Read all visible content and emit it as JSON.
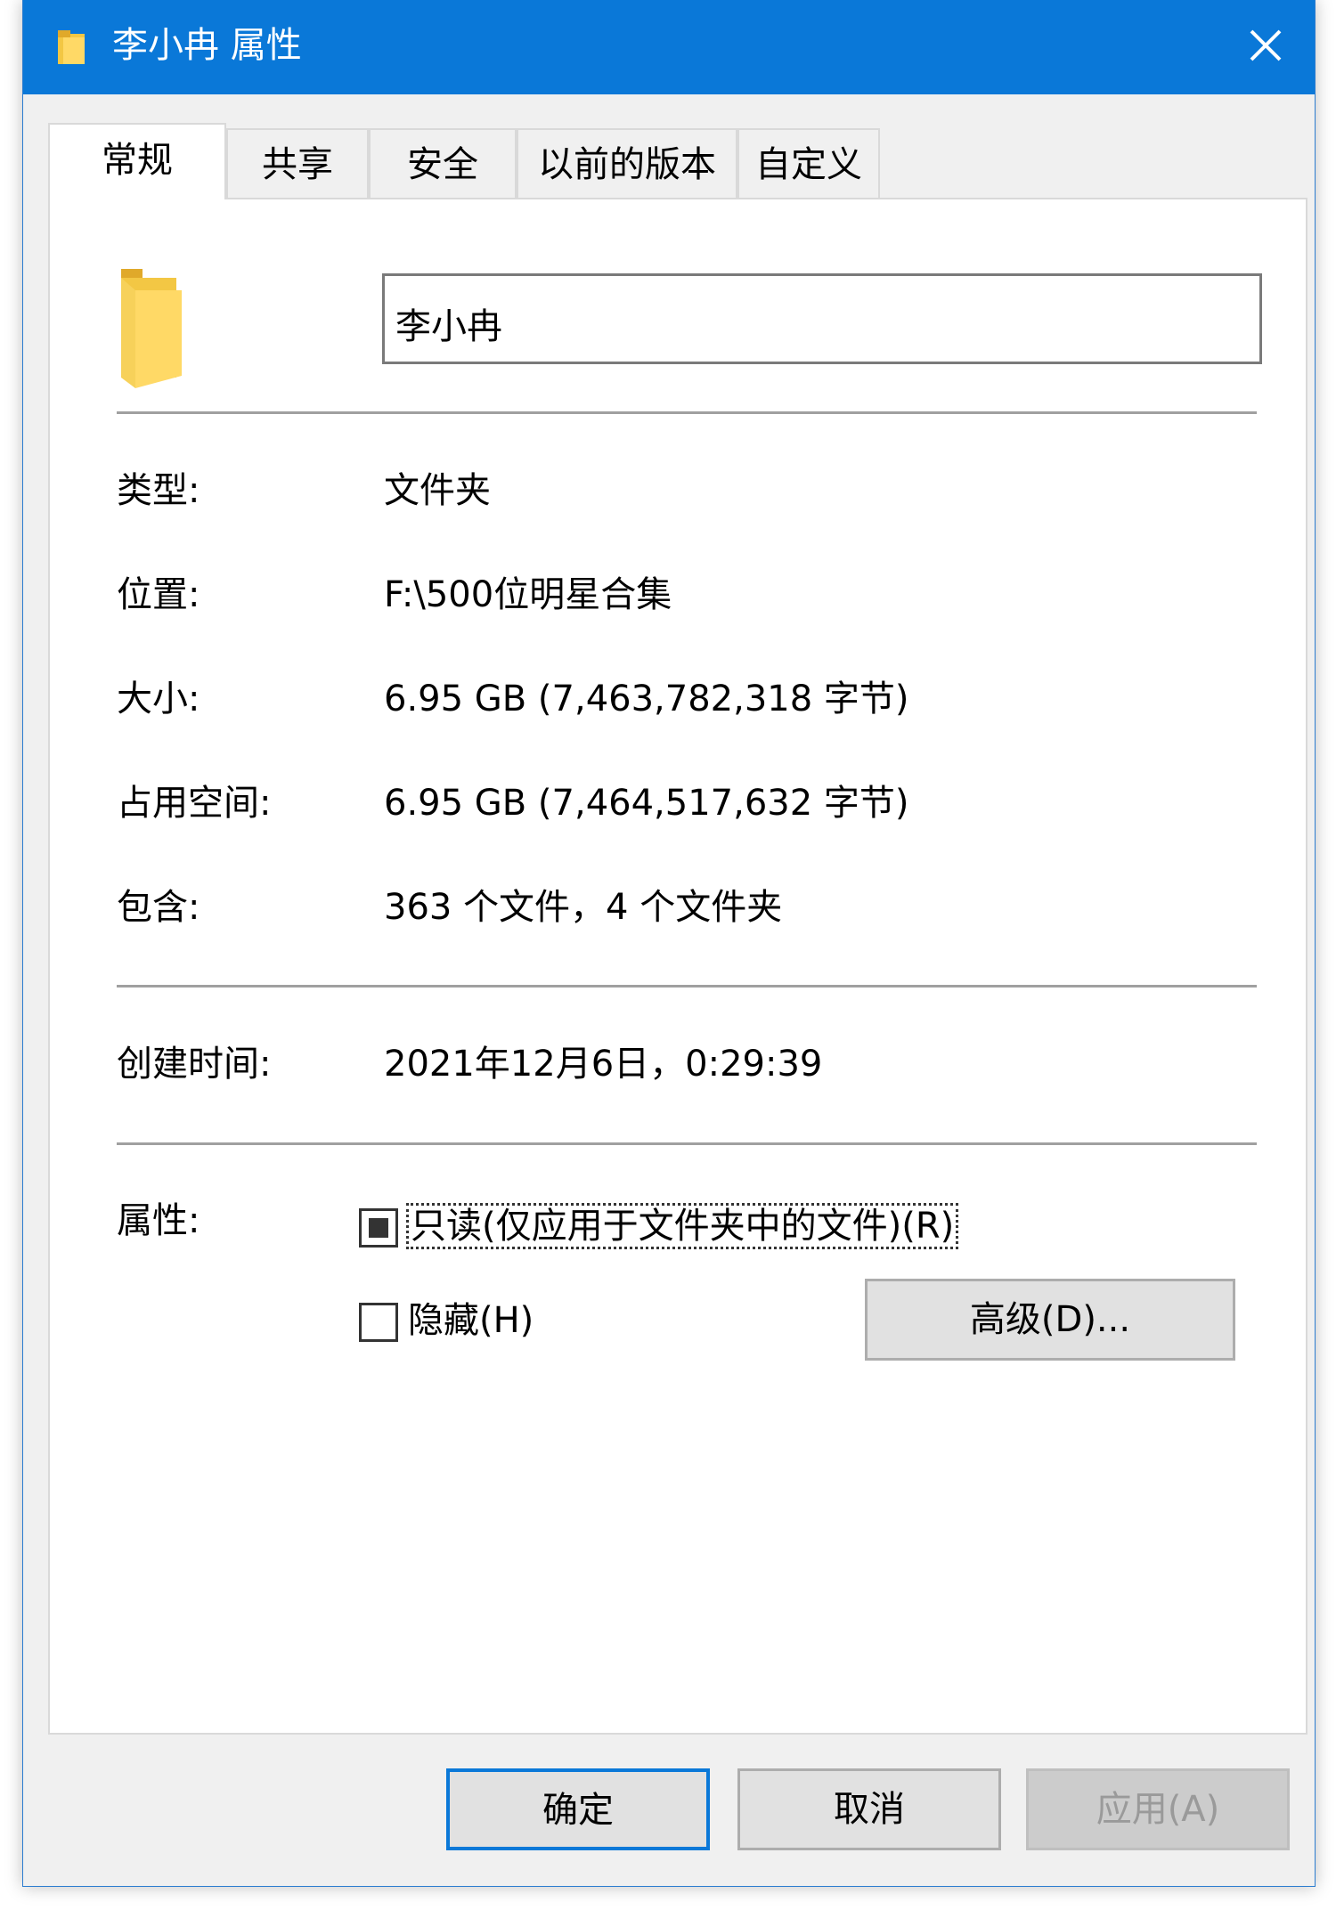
{
  "window": {
    "title": "李小冉 属性"
  },
  "tabs": [
    {
      "label": "常规"
    },
    {
      "label": "共享"
    },
    {
      "label": "安全"
    },
    {
      "label": "以前的版本"
    },
    {
      "label": "自定义"
    }
  ],
  "general": {
    "folder_name": "李小冉",
    "rows": [
      {
        "label": "类型:",
        "value": "文件夹"
      },
      {
        "label": "位置:",
        "value": "F:\\500位明星合集"
      },
      {
        "label": "大小:",
        "value": "6.95 GB (7,463,782,318 字节)"
      },
      {
        "label": "占用空间:",
        "value": "6.95 GB (7,464,517,632 字节)"
      },
      {
        "label": "包含:",
        "value": "363 个文件，4 个文件夹"
      }
    ],
    "created": {
      "label": "创建时间:",
      "value": "2021年12月6日，0:29:39"
    },
    "attributes": {
      "label": "属性:",
      "readonly": {
        "label": "只读(仅应用于文件夹中的文件)(R)",
        "state": "indeterminate"
      },
      "hidden": {
        "label": "隐藏(H)",
        "checked": false
      },
      "advanced_button": "高级(D)..."
    }
  },
  "buttons": {
    "ok": "确定",
    "cancel": "取消",
    "apply": "应用(A)"
  },
  "icons": {
    "folder": "folder-icon",
    "close": "close-icon"
  },
  "colors": {
    "titlebar": "#0a78d8",
    "folder_yellow": "#f3c744"
  }
}
